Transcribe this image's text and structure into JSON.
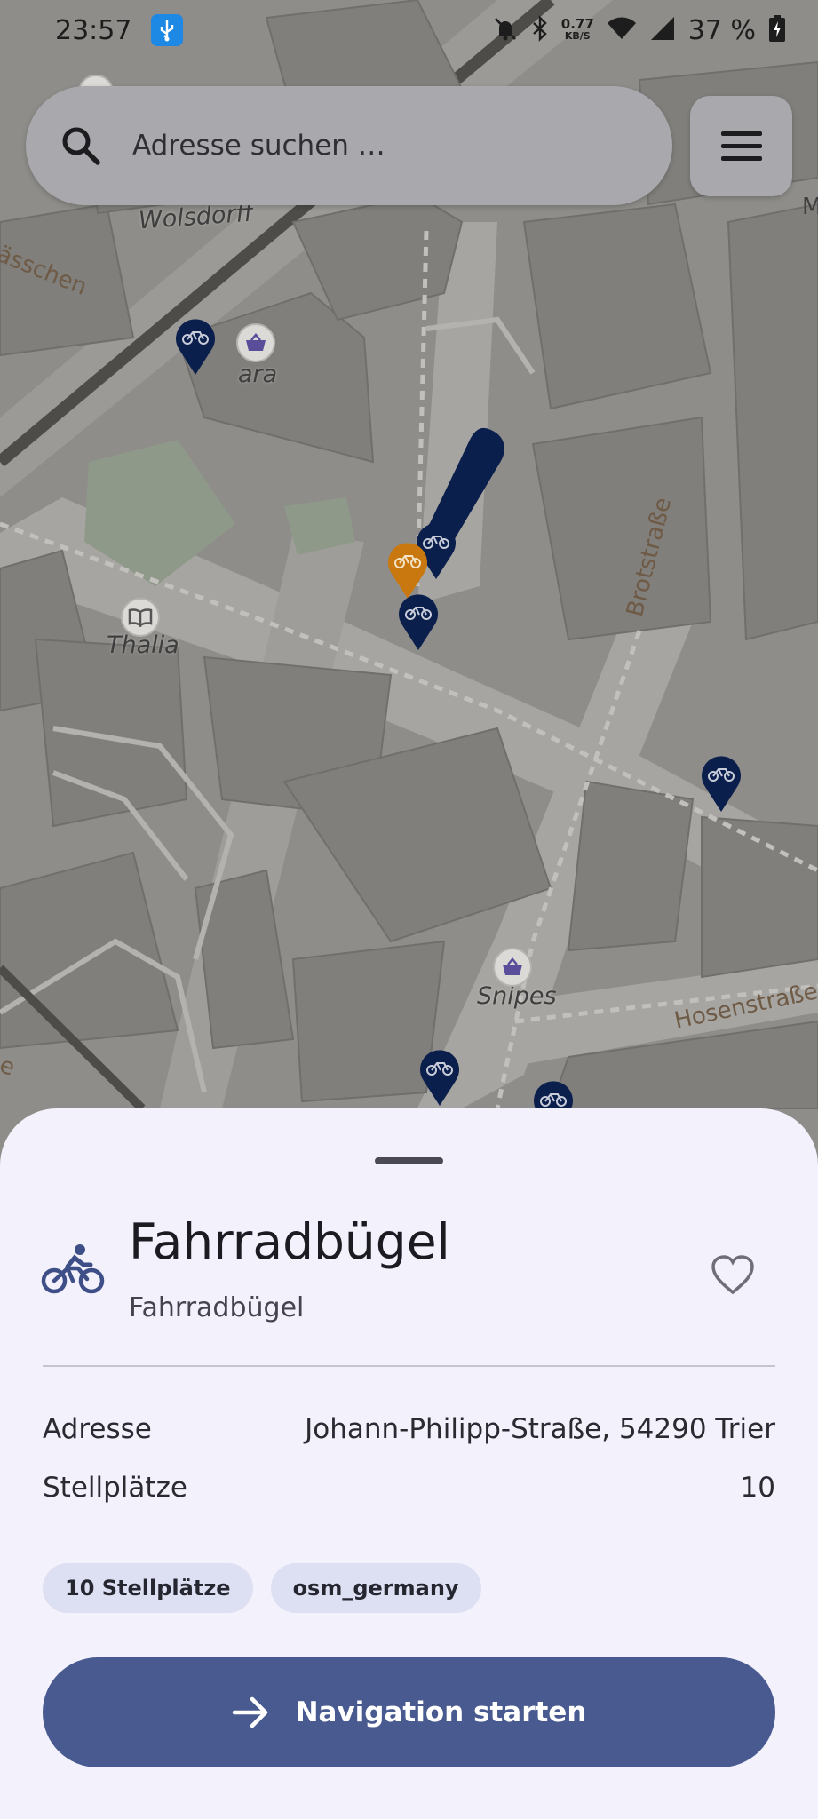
{
  "status_bar": {
    "time": "23:57",
    "net_speed_value": "0.77",
    "net_speed_unit": "KB/S",
    "battery_text": "37 %"
  },
  "search": {
    "placeholder": "Adresse suchen …"
  },
  "map": {
    "labels": {
      "wolsdorff": "Wolsdorff",
      "gasschen": "ässchen",
      "ara": "ara",
      "thalia": "Thalia",
      "snipes": "Snipes",
      "brotstrasse": "Brotstraße",
      "hosenstrasse": "Hosenstraße",
      "edge_m": "M",
      "edge_e": "e"
    },
    "colors": {
      "pin_default": "#0b1f4d",
      "pin_selected": "#c8780f"
    }
  },
  "place": {
    "icon": "bicycle-icon",
    "title": "Fahrradbügel",
    "subtitle": "Fahrradbügel",
    "favorite_icon": "heart-outline-icon"
  },
  "details": {
    "address_label": "Adresse",
    "address_value": "Johann-Philipp-Straße, 54290 Trier",
    "spaces_label": "Stellplätze",
    "spaces_value": "10"
  },
  "chips": [
    "10 Stellplätze",
    "osm_germany"
  ],
  "nav_button": {
    "label": "Navigation starten",
    "icon": "arrow-right-icon",
    "color": "#485a8f"
  }
}
